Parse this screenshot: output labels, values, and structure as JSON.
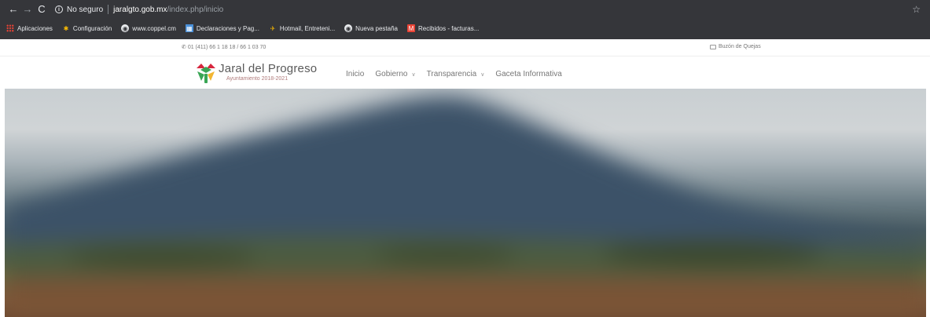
{
  "browser": {
    "secure_label": "No seguro",
    "url_host": "jaralgto.gob.mx",
    "url_path": "/index.php/inicio",
    "bookmarks": [
      {
        "label": "Aplicaciones",
        "icon": "apps-grid-icon"
      },
      {
        "label": "Configuración",
        "icon": "gear-icon"
      },
      {
        "label": "www.coppel.cm",
        "icon": "globe-icon"
      },
      {
        "label": "Declaraciones y Pag...",
        "icon": "declaraciones-icon"
      },
      {
        "label": "Hotmail, Entreteni...",
        "icon": "hotmail-icon"
      },
      {
        "label": "Nueva pestaña",
        "icon": "globe-icon"
      },
      {
        "label": "Recibidos - facturas...",
        "icon": "gmail-icon"
      }
    ]
  },
  "topbar": {
    "phone": "01 (411) 66 1 18 18 / 66 1 03 70",
    "quejas": "Buzón de Quejas"
  },
  "header": {
    "brand_title": "Jaral del Progreso",
    "brand_subtitle": "Ayuntamiento 2018-2021",
    "menu": [
      {
        "label": "Inicio",
        "has_dropdown": false
      },
      {
        "label": "Gobierno",
        "has_dropdown": true
      },
      {
        "label": "Transparencia",
        "has_dropdown": true
      },
      {
        "label": "Gaceta Informativa",
        "has_dropdown": false
      }
    ]
  },
  "colors": {
    "chrome_bg": "#35363a",
    "logo_red": "#d7263d",
    "logo_green": "#3aa655",
    "logo_yellow": "#f2b632",
    "text_gray": "#777777"
  }
}
